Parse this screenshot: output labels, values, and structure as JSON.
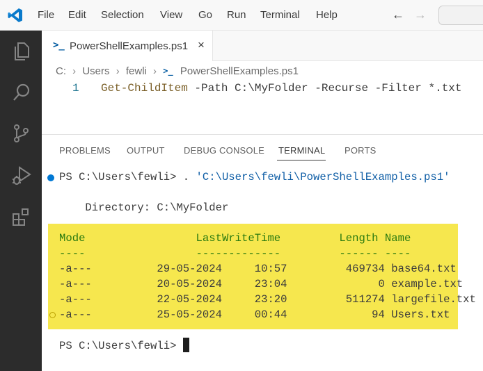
{
  "menu": [
    "File",
    "Edit",
    "Selection",
    "View",
    "Go",
    "Run",
    "Terminal",
    "Help"
  ],
  "nav": {
    "back_icon": "arrow-left-icon",
    "forward_icon": "arrow-right-icon"
  },
  "activity_bar": [
    "explorer-icon",
    "search-icon",
    "source-control-icon",
    "run-debug-icon",
    "extensions-icon"
  ],
  "editor": {
    "tab": {
      "label": "PowerShellExamples.ps1",
      "close": "×"
    },
    "breadcrumb": [
      "C:",
      "Users",
      "fewli",
      "PowerShellExamples.ps1"
    ],
    "line_number": "1",
    "code": {
      "cmdlet": "Get-ChildItem",
      "args": " -Path C:\\MyFolder -Recurse -Filter *.txt"
    }
  },
  "panel": {
    "tabs": [
      "PROBLEMS",
      "OUTPUT",
      "DEBUG CONSOLE",
      "TERMINAL",
      "PORTS"
    ],
    "active_tab": "TERMINAL",
    "terminal": {
      "command_prompt": "PS C:\\Users\\fewli> . ",
      "command_arg": "'C:\\Users\\fewli\\PowerShellExamples.ps1'",
      "directory_line": "    Directory: C:\\MyFolder",
      "header": "Mode                 LastWriteTime         Length Name",
      "separator": "----                 -------------         ------ ----",
      "rows": [
        "-a---          29-05-2024     10:57         469734 base64.txt",
        "-a---          20-05-2024     23:04              0 example.txt",
        "-a---          22-05-2024     23:20         511274 largefile.txt",
        "-a---          25-05-2024     00:44             94 Users.txt"
      ],
      "final_prompt": "PS C:\\Users\\fewli> "
    }
  },
  "colors": {
    "accent": "#0078d4",
    "highlight": "#f6e74e",
    "header_green": "#2a7a0f",
    "activity_bar": "#2c2c2c"
  }
}
